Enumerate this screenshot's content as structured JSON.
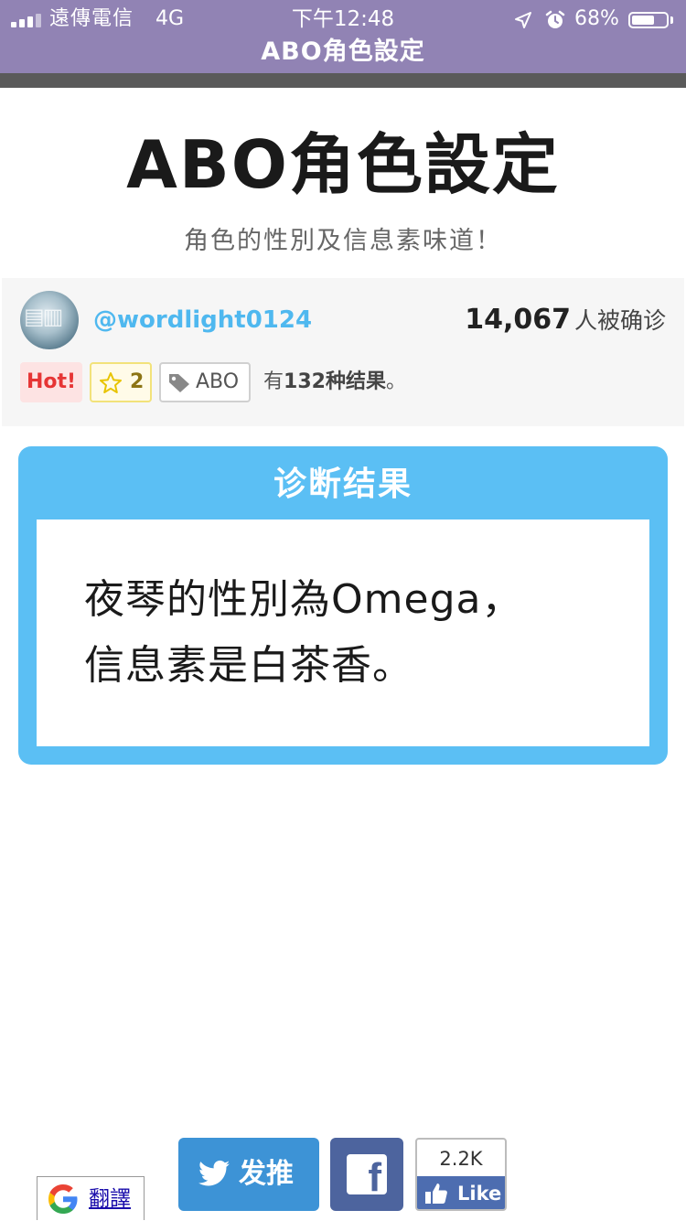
{
  "status_bar": {
    "carrier": "遠傳電信",
    "network": "4G",
    "time": "下午12:48",
    "battery_percent": "68%",
    "battery_level": 0.68
  },
  "nav": {
    "title": "ABO角色設定"
  },
  "header": {
    "title": "ABO角色設定",
    "subtitle": "角色的性別及信息素味道！"
  },
  "author": {
    "handle": "@wordlight0124",
    "diagnosed_count": "14,067",
    "diagnosed_suffix": "人被确诊"
  },
  "badges": {
    "hot": "Hot!",
    "favorites": "2",
    "tag": "ABO"
  },
  "result_count": {
    "prefix": "有",
    "number": "132种结果",
    "suffix": "。"
  },
  "result": {
    "header": "诊断结果",
    "line1": "夜琴的性別為Omega，",
    "line2": "信息素是白茶香。"
  },
  "share": {
    "tweet_label": "发推",
    "like_count": "2.2K",
    "like_label": "Like"
  },
  "translate": {
    "label": "翻譯"
  },
  "colors": {
    "status_bar": "#9183b4",
    "accent_blue": "#5bbff4",
    "handle_blue": "#4fb8ef",
    "twitter_blue": "#3d93d6",
    "facebook_blue": "#4d649e",
    "hot_red": "#e63535"
  },
  "icons": [
    "signal-icon",
    "location-icon",
    "alarm-icon",
    "battery-icon",
    "star-icon",
    "tag-icon",
    "twitter-bird-icon",
    "facebook-icon",
    "thumbs-up-icon",
    "google-icon"
  ]
}
